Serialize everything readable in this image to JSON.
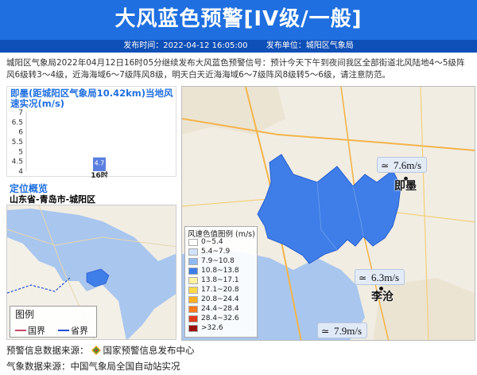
{
  "header": {
    "title": "大风蓝色预警[IV级/一般]",
    "publish_time": "发布时间：2022-04-12 16:05:00",
    "publish_unit": "发布单位：城阳区气象局"
  },
  "description": "城阳区气象局2022年04月12日16时05分继续发布大风蓝色预警信号：预计今天下午到夜间我区全部街道北风陆地4～5级阵风6级转3～4级，近海海域6～7级阵风8级，明天白天近海海域6～7级阵风8级转5～6级，请注意防范。",
  "wind_panel": {
    "title": "即墨(距城阳区气象局10.42km)当地风速实况(m/s)"
  },
  "chart_data": {
    "type": "bar",
    "title": "即墨(距城阳区气象局10.42km)当地风速实况(m/s)",
    "categories": [
      "16时"
    ],
    "values": [
      4.7
    ],
    "data_labels": [
      "4.7"
    ],
    "y_ticks": [
      "7",
      "6.5",
      "6",
      "5.5",
      "5",
      "4.5",
      "4"
    ],
    "ylim": [
      4,
      7
    ],
    "grid": false
  },
  "location": {
    "title": "定位概览",
    "name": "山东省-青岛市-城阳区"
  },
  "mini_legend": {
    "title": "图例",
    "items": [
      {
        "label": "国界",
        "color": "#c94a6a"
      },
      {
        "label": "省界",
        "color": "#1f4fd0"
      }
    ]
  },
  "wind_legend": {
    "title": "风速色值图例 (m/s)",
    "items": [
      {
        "label": "0~5.4",
        "color": "#ffffff"
      },
      {
        "label": "5.4~7.9",
        "color": "#cfe2fb"
      },
      {
        "label": "7.9~10.8",
        "color": "#8fb9f2"
      },
      {
        "label": "10.8~13.8",
        "color": "#3a7de8"
      },
      {
        "label": "13.8~17.1",
        "color": "#fff3a0"
      },
      {
        "label": "17.1~20.8",
        "color": "#ffd94a"
      },
      {
        "label": "20.8~24.4",
        "color": "#ffb020"
      },
      {
        "label": "24.4~28.4",
        "color": "#ff7a1a"
      },
      {
        "label": "28.4~32.6",
        "color": "#e23a1a"
      },
      {
        "label": ">32.6",
        "color": "#9a0d0d"
      }
    ]
  },
  "map_labels": {
    "wind_jimo": "7.6m/s",
    "wind_mid": "6.3m/s",
    "wind_bottom": "7.9m/s",
    "city_jimo": "即墨",
    "city_licang": "李沧"
  },
  "footer": {
    "warning_source": "预警信息数据来源：",
    "warning_source_name": "国家预警信息发布中心",
    "weather_source": "气象数据来源：中国气象局全国自动站实况"
  },
  "colors": {
    "header_bg": "#1f6fe0",
    "subbar_bg": "#0f4fb8",
    "accent": "#1f6fe0",
    "region_fill": "#3f7ee8",
    "sea": "#a9c6ee"
  }
}
